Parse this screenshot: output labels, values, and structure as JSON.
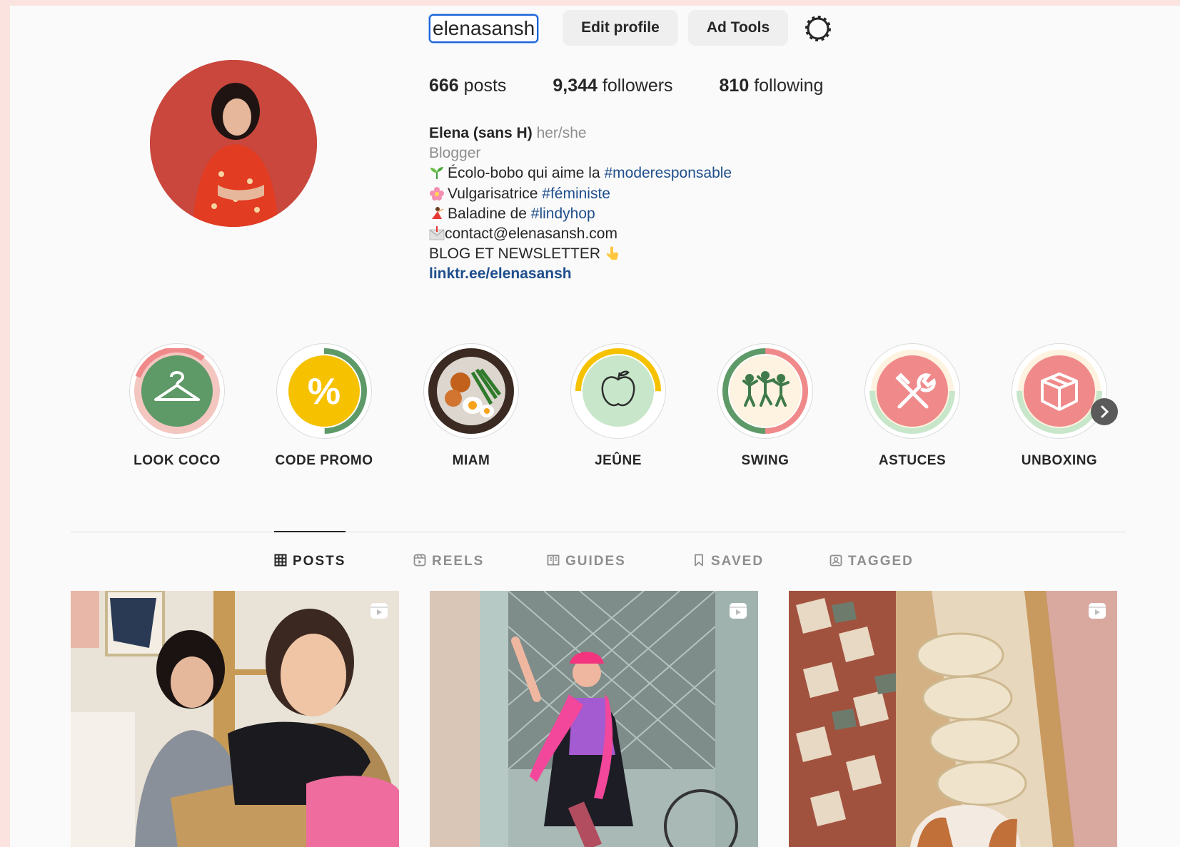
{
  "header": {
    "username": "elenasansh",
    "edit_profile_label": "Edit profile",
    "ad_tools_label": "Ad Tools",
    "settings_icon": "gear-icon"
  },
  "stats": {
    "posts_count": "666",
    "posts_label": "posts",
    "followers_count": "9,344",
    "followers_label": "followers",
    "following_count": "810",
    "following_label": "following"
  },
  "bio": {
    "name": "Elena (sans H)",
    "pronouns": "her/she",
    "category": "Blogger",
    "line1_text": "Écolo-bobo qui aime la ",
    "line1_tag": "#moderesponsable",
    "line2_text": "Vulgarisatrice ",
    "line2_tag": "#féministe",
    "line3_text": "Baladine de ",
    "line3_tag": "#lindyhop",
    "line4_text": "contact@elenasansh.com",
    "line5_text": "BLOG ET NEWSLETTER",
    "link": "linktr.ee/elenasansh"
  },
  "highlights": [
    {
      "label": "LOOK COCO",
      "icon": "hanger-icon"
    },
    {
      "label": "CODE PROMO",
      "icon": "percent-icon"
    },
    {
      "label": "MIAM",
      "icon": "food-photo"
    },
    {
      "label": "JEÛNE",
      "icon": "apple-icon"
    },
    {
      "label": "SWING",
      "icon": "dancers-icon"
    },
    {
      "label": "ASTUCES",
      "icon": "tools-icon"
    },
    {
      "label": "UNBOXING",
      "icon": "box-icon"
    }
  ],
  "tabs": [
    {
      "label": "POSTS",
      "icon": "grid-icon",
      "active": true
    },
    {
      "label": "REELS",
      "icon": "reels-icon",
      "active": false
    },
    {
      "label": "GUIDES",
      "icon": "guides-icon",
      "active": false
    },
    {
      "label": "SAVED",
      "icon": "bookmark-icon",
      "active": false
    },
    {
      "label": "TAGGED",
      "icon": "tagged-icon",
      "active": false
    }
  ],
  "colors": {
    "link_blue": "#1f4e8c",
    "highlight_green": "#5e9a68",
    "highlight_pink": "#f08a8a",
    "highlight_yellow": "#f6c200"
  }
}
